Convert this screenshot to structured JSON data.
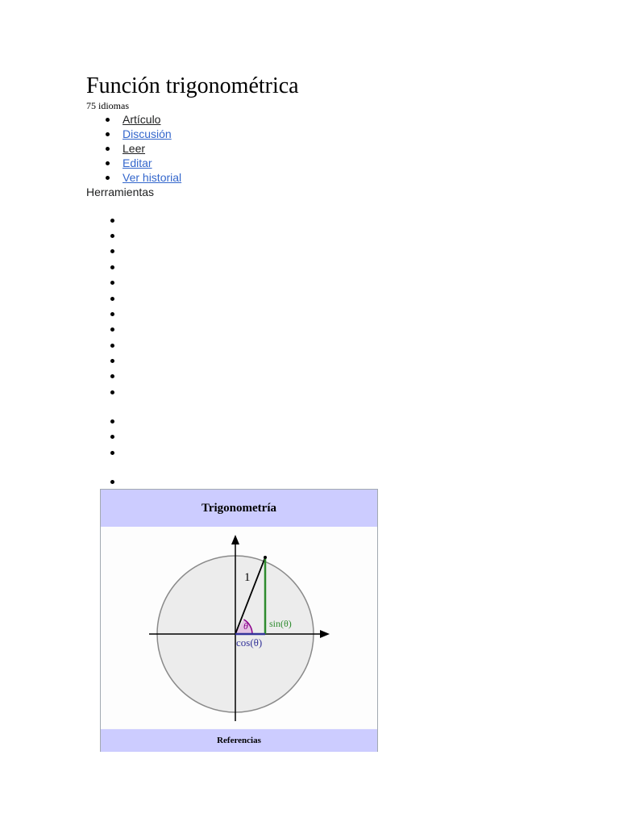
{
  "page": {
    "title": "Función trigonométrica",
    "language_count": "75 idiomas"
  },
  "tabs": [
    {
      "label": "Artículo",
      "active": true
    },
    {
      "label": "Discusión",
      "active": false
    },
    {
      "label": "Leer",
      "active": true
    },
    {
      "label": "Editar",
      "active": false
    },
    {
      "label": "Ver historial",
      "active": false
    }
  ],
  "tools": {
    "label": "Herramientas"
  },
  "infobox": {
    "title": "Trigonometría",
    "footer": "Referencias",
    "diagram": {
      "radius_label": "1",
      "angle_label": "θ",
      "sin_label": "sin(θ)",
      "cos_label": "cos(θ)"
    }
  },
  "colors": {
    "link": "#3366cc",
    "infobox_header": "#ccccff",
    "sin_line": "#2e8b2e",
    "cos_line": "#333399",
    "angle_arc": "#8b008b"
  }
}
